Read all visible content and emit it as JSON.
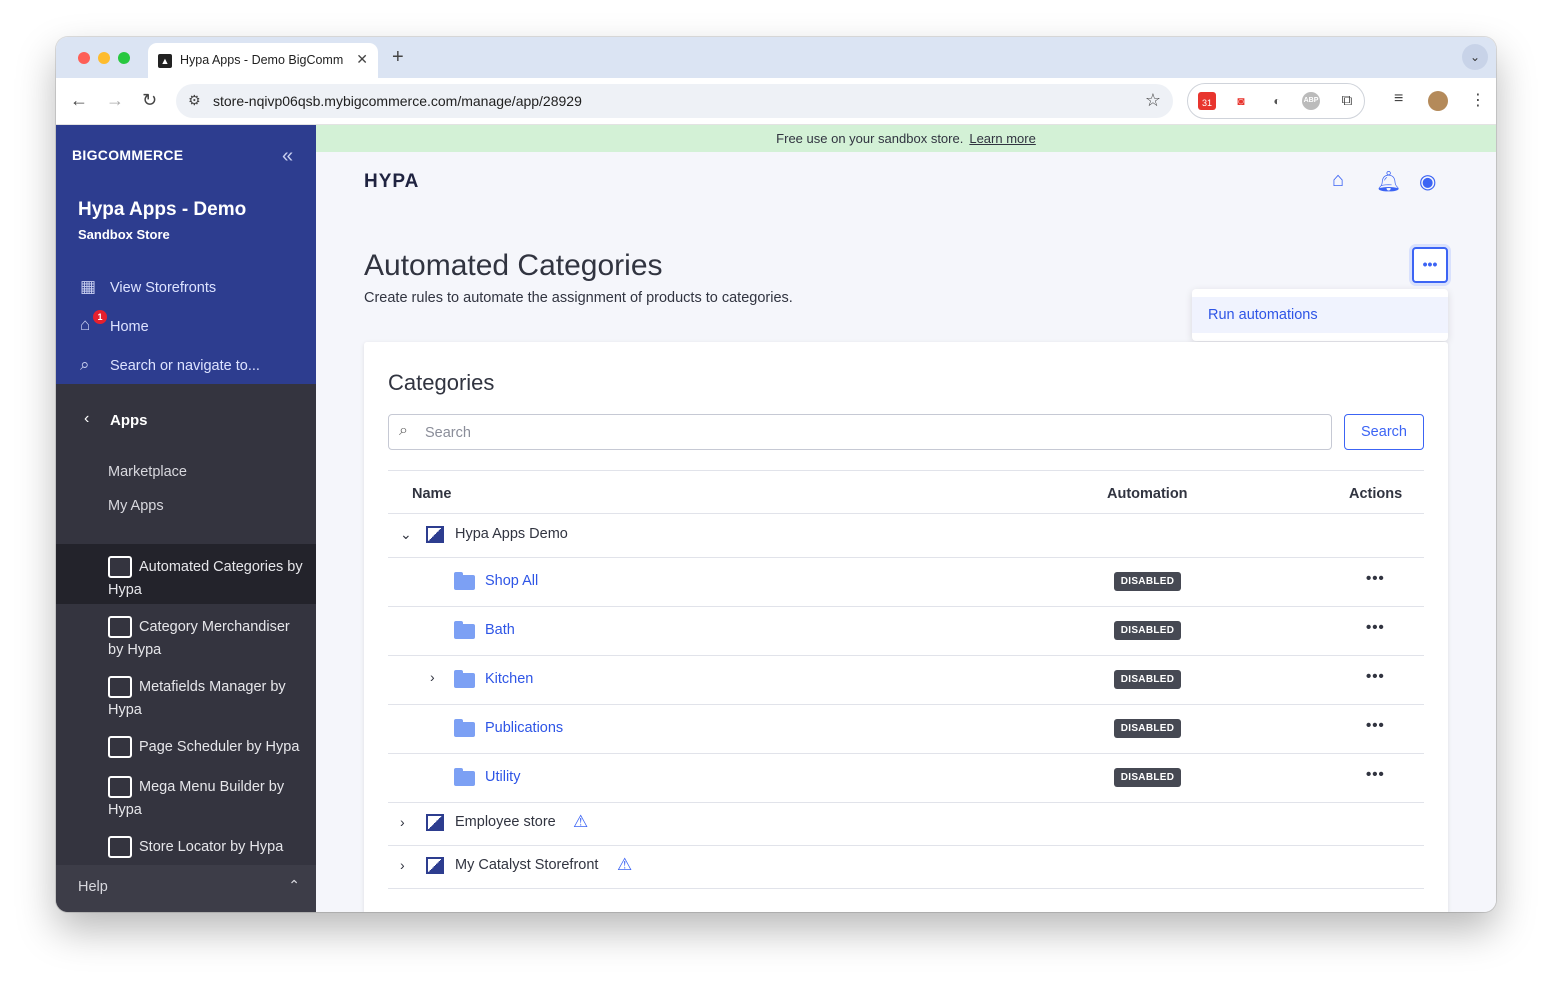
{
  "browser": {
    "tab_title": "Hypa Apps - Demo BigComm",
    "url": "store-nqivp06qsb.mybigcommerce.com/manage/app/28929",
    "calendar_badge": "31",
    "abp_label": "ABP"
  },
  "sidebar": {
    "logo": "BIGCOMMERCE",
    "store_name": "Hypa Apps - Demo",
    "store_type": "Sandbox Store",
    "nav": [
      {
        "label": "View Storefronts"
      },
      {
        "label": "Home",
        "badge": "1"
      },
      {
        "label": "Search or navigate to..."
      }
    ],
    "section": "Apps",
    "sub_items": [
      "Marketplace",
      "My Apps"
    ],
    "apps": [
      {
        "label": "Automated Categories by Hypa",
        "active": true
      },
      {
        "label": "Category Merchandiser by Hypa",
        "active": false
      },
      {
        "label": "Metafields Manager by Hypa",
        "active": false
      },
      {
        "label": "Page Scheduler by Hypa",
        "active": false
      },
      {
        "label": "Mega Menu Builder by Hypa",
        "active": false
      },
      {
        "label": "Store Locator by Hypa",
        "active": false
      }
    ],
    "help": "Help"
  },
  "banner": {
    "text": "Free use on your sandbox store.",
    "link": "Learn more"
  },
  "app": {
    "logo": "HYPA",
    "title": "Automated Categories",
    "subtitle": "Create rules to automate the assignment of products to categories.",
    "more_label": "•••",
    "dropdown_item": "Run automations"
  },
  "categories": {
    "title": "Categories",
    "search_placeholder": "Search",
    "search_button": "Search",
    "columns": {
      "name": "Name",
      "automation": "Automation",
      "actions": "Actions"
    },
    "stores": [
      {
        "name": "Hypa Apps Demo",
        "expanded": true,
        "warning": false
      },
      {
        "name": "Employee store",
        "expanded": false,
        "warning": true
      },
      {
        "name": "My Catalyst Storefront",
        "expanded": false,
        "warning": true
      }
    ],
    "items": [
      {
        "name": "Shop All",
        "status": "DISABLED",
        "has_children": false
      },
      {
        "name": "Bath",
        "status": "DISABLED",
        "has_children": false
      },
      {
        "name": "Kitchen",
        "status": "DISABLED",
        "has_children": true
      },
      {
        "name": "Publications",
        "status": "DISABLED",
        "has_children": false
      },
      {
        "name": "Utility",
        "status": "DISABLED",
        "has_children": false
      }
    ],
    "actions_label": "•••"
  },
  "colors": {
    "sidebar_top": "#2d3d8f",
    "sidebar_dark": "#34343f",
    "accent": "#3c64f4",
    "banner": "#d3f1d6",
    "status_badge": "#464953"
  }
}
